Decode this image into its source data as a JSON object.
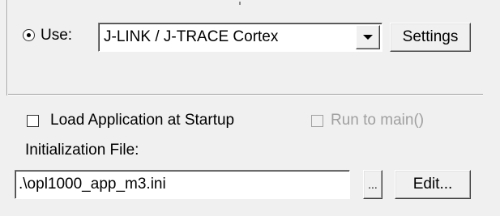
{
  "debugger": {
    "use_label": "Use:",
    "driver_selected": "J-LINK / J-TRACE Cortex",
    "settings_label": "Settings"
  },
  "startup": {
    "load_app_label": "Load Application at Startup",
    "load_app_checked": false,
    "run_to_main_label": "Run to main()",
    "run_to_main_checked": false,
    "run_to_main_enabled": false
  },
  "init_file": {
    "label": "Initialization File:",
    "value": ".\\opl1000_app_m3.ini",
    "browse_label": "...",
    "edit_label": "Edit..."
  }
}
